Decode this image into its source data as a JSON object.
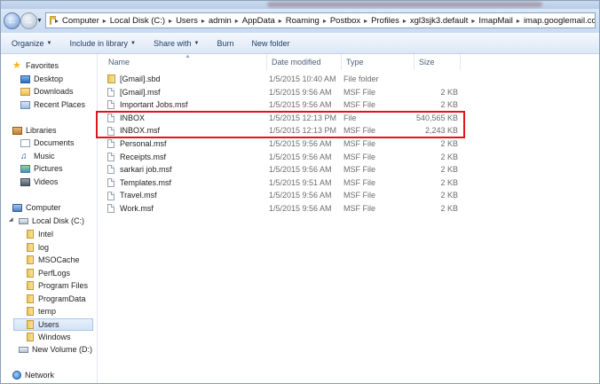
{
  "address_bar": {
    "breadcrumbs": [
      "Computer",
      "Local Disk (C:)",
      "Users",
      "admin",
      "AppData",
      "Roaming",
      "Postbox",
      "Profiles",
      "xgl3sjk3.default",
      "ImapMail",
      "imap.googlemail.com"
    ]
  },
  "toolbar": {
    "organize": "Organize",
    "include_in_library": "Include in library",
    "share_with": "Share with",
    "burn": "Burn",
    "new_folder": "New folder"
  },
  "nav_pane": {
    "favorites": "Favorites",
    "desktop": "Desktop",
    "downloads": "Downloads",
    "recent_places": "Recent Places",
    "libraries": "Libraries",
    "documents": "Documents",
    "music": "Music",
    "pictures": "Pictures",
    "videos": "Videos",
    "computer": "Computer",
    "local_disk": "Local Disk (C:)",
    "folders": [
      "Intel",
      "log",
      "MSOCache",
      "PerfLogs",
      "Program Files",
      "ProgramData",
      "temp",
      "Users",
      "Windows"
    ],
    "selected_folder": "Users",
    "new_volume": "New Volume (D:)",
    "network": "Network"
  },
  "columns": {
    "name": "Name",
    "date_modified": "Date modified",
    "type": "Type",
    "size": "Size"
  },
  "files": [
    {
      "name": "[Gmail].sbd",
      "date": "1/5/2015 10:40 AM",
      "type": "File folder",
      "size": "",
      "kind": "folder"
    },
    {
      "name": "[Gmail].msf",
      "date": "1/5/2015 9:56 AM",
      "type": "MSF File",
      "size": "2 KB",
      "kind": "file"
    },
    {
      "name": "Important Jobs.msf",
      "date": "1/5/2015 9:56 AM",
      "type": "MSF File",
      "size": "2 KB",
      "kind": "file"
    },
    {
      "name": "INBOX",
      "date": "1/5/2015 12:13 PM",
      "type": "File",
      "size": "540,565 KB",
      "kind": "file"
    },
    {
      "name": "INBOX.msf",
      "date": "1/5/2015 12:13 PM",
      "type": "MSF File",
      "size": "2,243 KB",
      "kind": "file"
    },
    {
      "name": "Personal.msf",
      "date": "1/5/2015 9:56 AM",
      "type": "MSF File",
      "size": "2 KB",
      "kind": "file"
    },
    {
      "name": "Receipts.msf",
      "date": "1/5/2015 9:56 AM",
      "type": "MSF File",
      "size": "2 KB",
      "kind": "file"
    },
    {
      "name": "sarkari job.msf",
      "date": "1/5/2015 9:56 AM",
      "type": "MSF File",
      "size": "2 KB",
      "kind": "file"
    },
    {
      "name": "Templates.msf",
      "date": "1/5/2015 9:51 AM",
      "type": "MSF File",
      "size": "2 KB",
      "kind": "file"
    },
    {
      "name": "Travel.msf",
      "date": "1/5/2015 9:56 AM",
      "type": "MSF File",
      "size": "2 KB",
      "kind": "file"
    },
    {
      "name": "Work.msf",
      "date": "1/5/2015 9:56 AM",
      "type": "MSF File",
      "size": "2 KB",
      "kind": "file"
    }
  ],
  "highlight": {
    "color": "#e0141e"
  }
}
